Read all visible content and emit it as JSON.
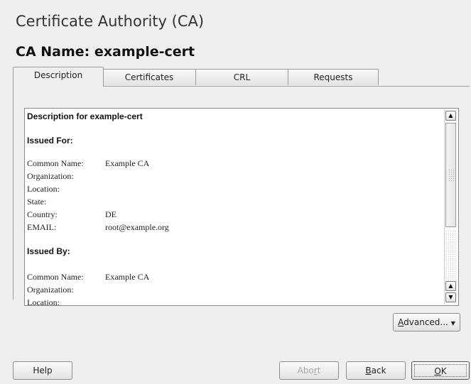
{
  "window": {
    "title": "Certificate Authority (CA)"
  },
  "ca": {
    "heading": "CA Name: example-cert"
  },
  "tabs": [
    {
      "label": "Description",
      "active": true
    },
    {
      "label": "Certificates"
    },
    {
      "label": "CRL"
    },
    {
      "label": "Requests"
    }
  ],
  "description": {
    "title": "Description for example-cert",
    "issued_for": {
      "heading": "Issued For:",
      "rows": [
        {
          "key": "Common Name:",
          "value": "Example CA"
        },
        {
          "key": "Organization:",
          "value": ""
        },
        {
          "key": "Location:",
          "value": ""
        },
        {
          "key": "State:",
          "value": ""
        },
        {
          "key": "Country:",
          "value": "DE"
        },
        {
          "key": "EMAIL:",
          "value": "root@example.org"
        }
      ]
    },
    "issued_by": {
      "heading": "Issued By:",
      "rows": [
        {
          "key": "Common Name:",
          "value": "Example CA"
        },
        {
          "key": "Organization:",
          "value": ""
        },
        {
          "key": "Location:",
          "value": ""
        }
      ]
    }
  },
  "scrollbar": {
    "up_icon": "arrow-up-icon",
    "down_icon": "arrow-down-icon"
  },
  "buttons": {
    "advanced": {
      "mnemonic": "A",
      "rest": "dvanced...",
      "icon": "chevron-down-icon"
    },
    "help": "Help",
    "abort": {
      "pre": "Abo",
      "mnemonic": "r",
      "post": "t"
    },
    "back": {
      "mnemonic": "B",
      "rest": "ack"
    },
    "ok": {
      "mnemonic": "O",
      "rest": "K"
    }
  }
}
